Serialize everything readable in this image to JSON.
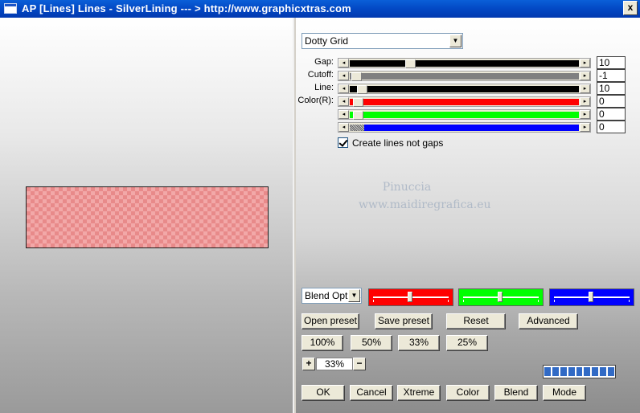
{
  "window": {
    "title": "AP [Lines]  Lines - SilverLining     --- > http://www.graphicxtras.com",
    "close_label": "x"
  },
  "preset_select": {
    "value": "Dotty Grid"
  },
  "sliders": [
    {
      "label": "Gap:",
      "value": "10",
      "color": "#000000",
      "position": 0.24
    },
    {
      "label": "Cutoff:",
      "value": "-1",
      "color": "#808080",
      "position": 0.0
    },
    {
      "label": "Line:",
      "value": "10",
      "color": "#000000",
      "position": 0.03
    },
    {
      "label": "Color(R):",
      "value": "0",
      "color": "#ff0000",
      "position": 0.0
    },
    {
      "label": "",
      "value": "0",
      "color": "#00ff00",
      "position": 0.0
    },
    {
      "label": "",
      "value": "0",
      "color": "#0000ff",
      "position": 0.0
    }
  ],
  "checkbox": {
    "label": "Create lines not gaps",
    "checked": true
  },
  "watermark": {
    "line1": "Pinuccia",
    "line2": "www.maidiregrafica.eu"
  },
  "blend_select": {
    "value": "Blend Options"
  },
  "color_boxes": [
    {
      "color": "#ff0000",
      "knob": 0.48
    },
    {
      "color": "#00ff00",
      "knob": 0.48
    },
    {
      "color": "#0000ff",
      "knob": 0.48
    }
  ],
  "preset_buttons": {
    "open": "Open preset",
    "save": "Save preset",
    "reset": "Reset",
    "advanced": "Advanced"
  },
  "zoom_buttons": [
    "100%",
    "50%",
    "33%",
    "25%"
  ],
  "zoom": {
    "plus": "+",
    "minus": "−",
    "value": "33%"
  },
  "progress": {
    "segments": 9
  },
  "bottom_buttons": {
    "ok": "OK",
    "cancel": "Cancel",
    "xtreme": "Xtreme",
    "color": "Color",
    "blend": "Blend",
    "mode": "Mode"
  }
}
